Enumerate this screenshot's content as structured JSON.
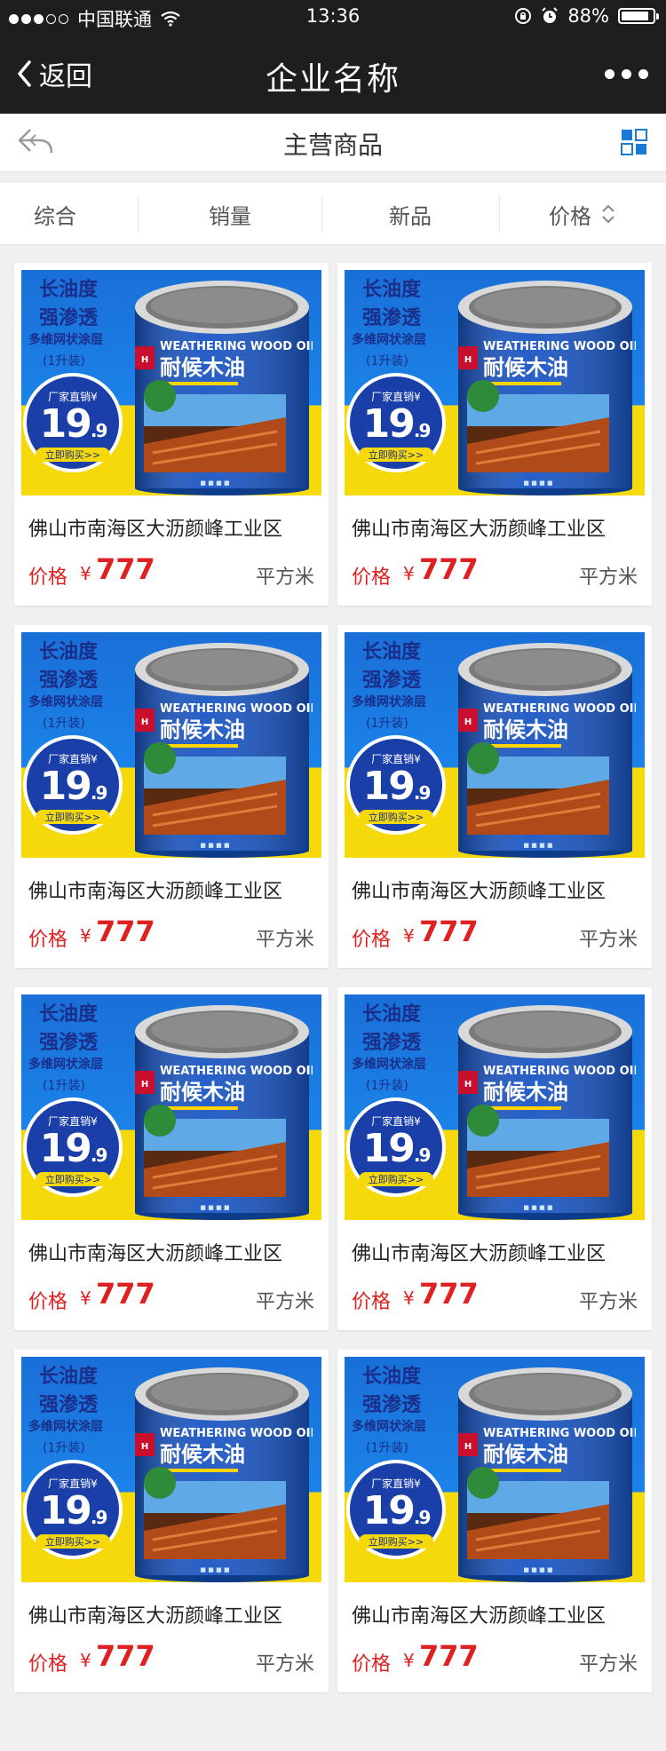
{
  "status_bar": {
    "carrier": "中国联通",
    "time": "13:36",
    "battery_text": "88%",
    "battery_level": 0.88,
    "signal_bars_filled": 3,
    "signal_bars_total": 5
  },
  "nav": {
    "back_label": "返回",
    "title": "企业名称"
  },
  "sub_header": {
    "title": "主营商品"
  },
  "sort_tabs": [
    "综合",
    "销量",
    "新品",
    "价格"
  ],
  "product_image": {
    "line1": "长油度",
    "line2": "强渗透",
    "line3": "多维网状涂层",
    "line4": "(1升装)",
    "badge_top": "厂家直销¥",
    "badge_price_main": "19",
    "badge_price_decimal": ".9",
    "badge_bottom": "立即购买>>",
    "brand_en": "WEATHERING WOOD OIL",
    "brand_cn": "耐候木油",
    "brand_logo": "HUIFU"
  },
  "products": [
    {
      "name": "佛山市南海区大沥颜峰工业区",
      "price_label": "价格",
      "currency": "¥",
      "price": "777",
      "unit": "平方米"
    },
    {
      "name": "佛山市南海区大沥颜峰工业区",
      "price_label": "价格",
      "currency": "¥",
      "price": "777",
      "unit": "平方米"
    },
    {
      "name": "佛山市南海区大沥颜峰工业区",
      "price_label": "价格",
      "currency": "¥",
      "price": "777",
      "unit": "平方米"
    },
    {
      "name": "佛山市南海区大沥颜峰工业区",
      "price_label": "价格",
      "currency": "¥",
      "price": "777",
      "unit": "平方米"
    },
    {
      "name": "佛山市南海区大沥颜峰工业区",
      "price_label": "价格",
      "currency": "¥",
      "price": "777",
      "unit": "平方米"
    },
    {
      "name": "佛山市南海区大沥颜峰工业区",
      "price_label": "价格",
      "currency": "¥",
      "price": "777",
      "unit": "平方米"
    },
    {
      "name": "佛山市南海区大沥颜峰工业区",
      "price_label": "价格",
      "currency": "¥",
      "price": "777",
      "unit": "平方米"
    },
    {
      "name": "佛山市南海区大沥颜峰工业区",
      "price_label": "价格",
      "currency": "¥",
      "price": "777",
      "unit": "平方米"
    }
  ],
  "colors": {
    "nav_bg": "#1e1e1e",
    "price_red": "#e02020",
    "accent_blue": "#1a7bd6"
  }
}
